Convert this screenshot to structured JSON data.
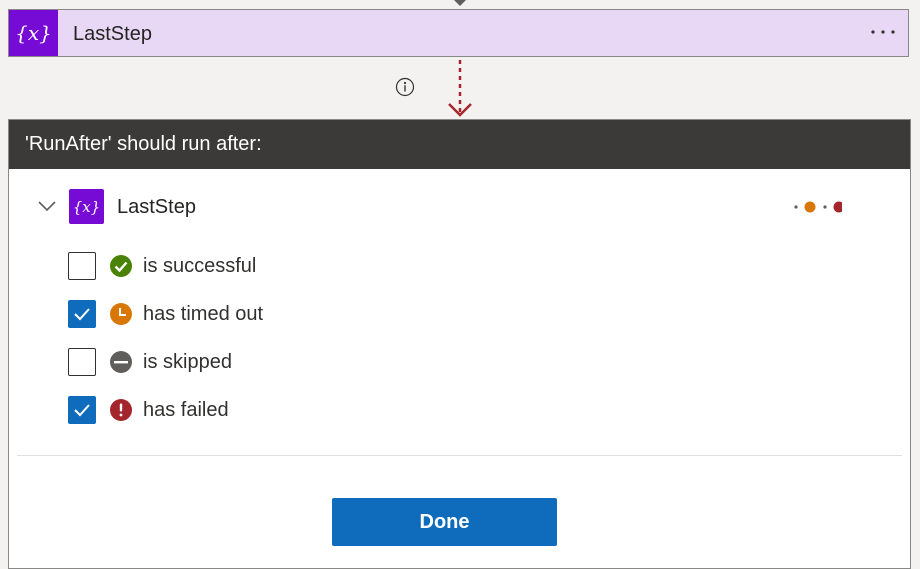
{
  "action_card": {
    "icon_glyph": "{x}",
    "title": "LastStep",
    "more_label": "···"
  },
  "panel": {
    "header": "'RunAfter' should run after:",
    "step": {
      "icon_glyph": "{x}",
      "name": "LastStep"
    },
    "options": [
      {
        "label": "is successful",
        "checked": false,
        "icon": "success-check-icon",
        "color": "#498205"
      },
      {
        "label": "has timed out",
        "checked": true,
        "icon": "clock-icon",
        "color": "#d97706"
      },
      {
        "label": "is skipped",
        "checked": false,
        "icon": "skip-icon",
        "color": "#605e5c"
      },
      {
        "label": "has failed",
        "checked": true,
        "icon": "error-icon",
        "color": "#a4262c"
      }
    ],
    "done_label": "Done"
  },
  "colors": {
    "accent_purple": "#770bd6",
    "card_bg": "#e8d7f5",
    "header_bg": "#3b3a39",
    "primary_blue": "#0f6cbd",
    "connector_red": "#a4262c",
    "timed_out_orange": "#d97706"
  }
}
